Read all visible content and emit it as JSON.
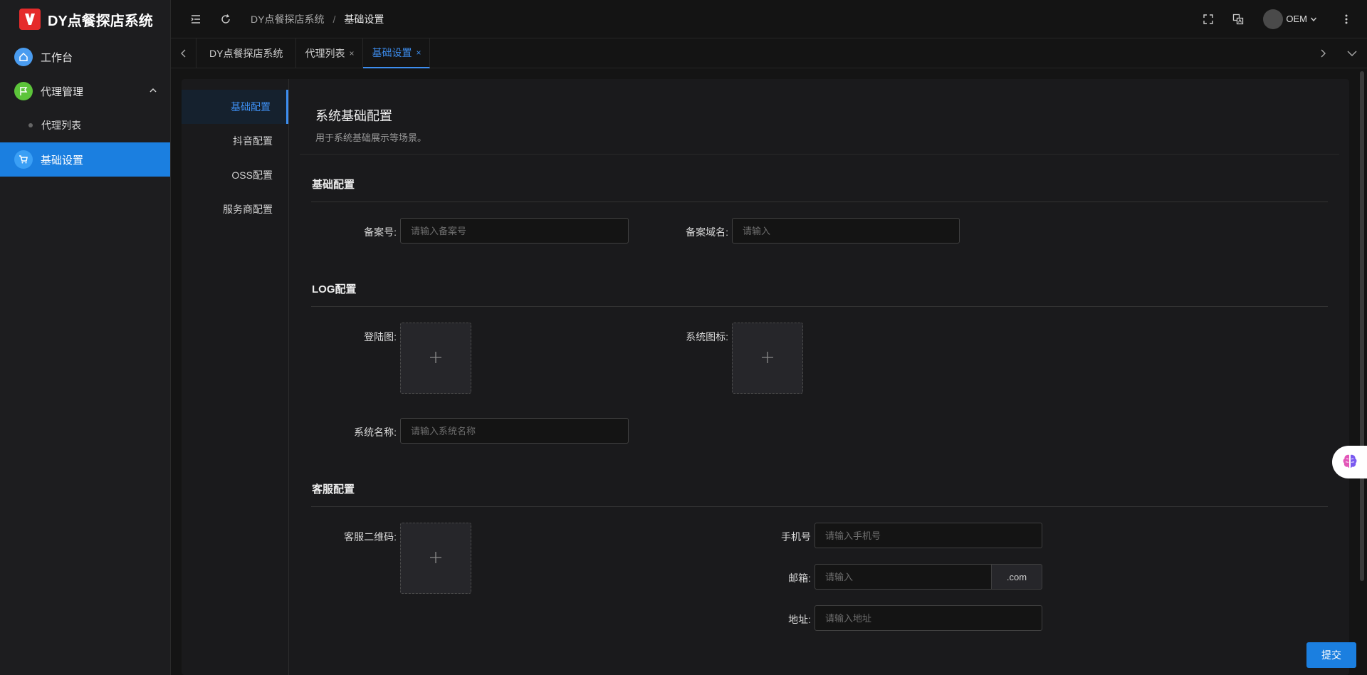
{
  "app": {
    "title": "DY点餐探店系统"
  },
  "sidebar": {
    "items": [
      {
        "label": "工作台"
      },
      {
        "label": "代理管理"
      },
      {
        "label": "代理列表"
      },
      {
        "label": "基础设置"
      }
    ]
  },
  "header": {
    "breadcrumb": [
      "DY点餐探店系统",
      "基础设置"
    ],
    "separator": "/",
    "user": "OEM"
  },
  "tabs": [
    {
      "label": "DY点餐探店系统"
    },
    {
      "label": "代理列表",
      "close": "×"
    },
    {
      "label": "基础设置",
      "close": "×"
    }
  ],
  "leftnav": [
    "基础配置",
    "抖音配置",
    "OSS配置",
    "服务商配置"
  ],
  "panel": {
    "title": "系统基础配置",
    "subtitle": "用于系统基础展示等场景。",
    "sections": {
      "basic": {
        "title": "基础配置",
        "beian_label": "备案号:",
        "beian_placeholder": "请输入备案号",
        "domain_label": "备案域名:",
        "domain_placeholder": "请输入"
      },
      "log": {
        "title": "LOG配置",
        "login_label": "登陆图:",
        "icon_label": "系统图标:",
        "name_label": "系统名称:",
        "name_placeholder": "请输入系统名称"
      },
      "service": {
        "title": "客服配置",
        "qrcode_label": "客服二维码:",
        "phone_label": "手机号",
        "phone_placeholder": "请输入手机号",
        "email_label": "邮箱:",
        "email_placeholder": "请输入",
        "email_suffix": ".com",
        "address_label": "地址:",
        "address_placeholder": "请输入地址"
      }
    },
    "upload_plus": "+"
  },
  "footer": {
    "submit_label": "提交"
  },
  "colors": {
    "accent": "#1b7fe0",
    "background": "#141414",
    "logo": "#e52b2b"
  }
}
